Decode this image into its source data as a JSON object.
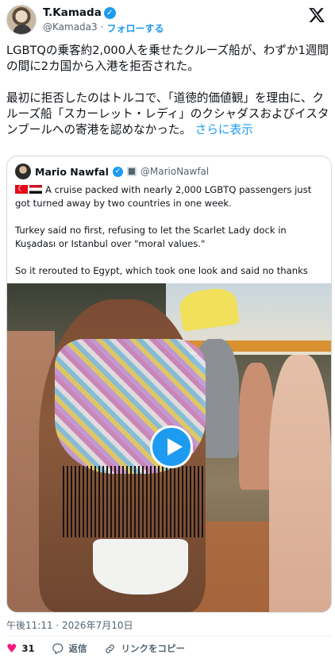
{
  "author": {
    "display_name": "T.Kamada",
    "handle": "@Kamada3",
    "separator": "·",
    "follow_label": "フォローする"
  },
  "tweet": {
    "text": "LGBTQの乗客約2,000人を乗せたクルーズ船が、わずか1週間の間に2カ国から入港を拒否された。\n\n最初に拒否したのはトルコで、「道徳的価値観」を理由に、クルーズ船「スカーレット・レディ」のクシャダスおよびイスタンブールへの寄港を認めなかった。",
    "more_label": "さらに表示"
  },
  "quoted": {
    "display_name": "Mario Nawfal",
    "handle": "@MarioNawfal",
    "text": "A cruise packed with nearly 2,000 LGBTQ passengers just got turned away by two countries in one week.\n\nTurkey said no first, refusing to let the Scarlet Lady dock in Kuşadası or Istanbul over \"moral values.\"\n\nSo it rerouted to Egypt, which took one look and said no thanks",
    "media_icons": {
      "flags": [
        "turkey-flag-icon",
        "egypt-flag-icon"
      ],
      "play": "play-icon"
    }
  },
  "meta": {
    "timestamp": "午後11:11 · 2026年7月10日"
  },
  "actions": {
    "like_count": "31",
    "reply_label": "返信",
    "copy_link_label": "リンクをコピー"
  },
  "colors": {
    "accent": "#1d9bf0",
    "like": "#f91880",
    "muted": "#536471",
    "text": "#0f1419",
    "border": "#cfd9de"
  }
}
